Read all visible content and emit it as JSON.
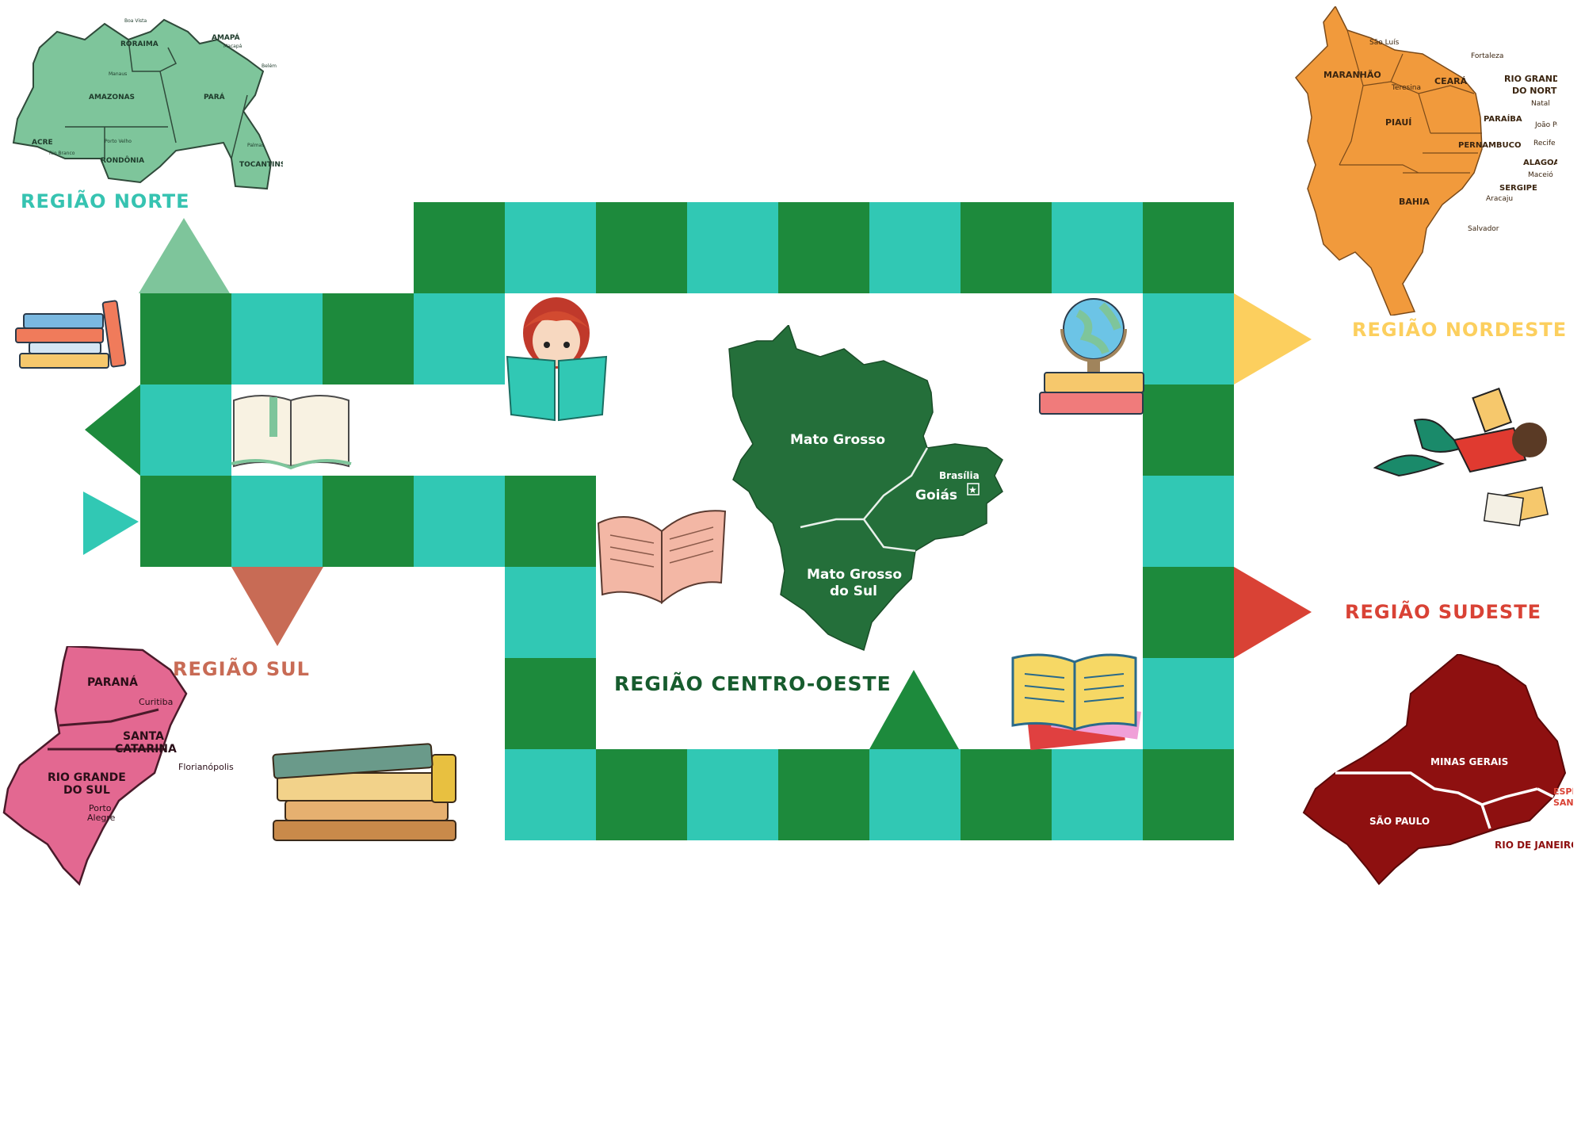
{
  "colors": {
    "dark_green": "#1d8a3c",
    "teal": "#31c8b4",
    "norte": "#7ec59b",
    "nordeste": "#f19a3c",
    "sul": "#e36891",
    "sudeste": "#8e1010",
    "centro_oeste": "#246f3a",
    "label_norte": "#36c3b1",
    "label_nordeste": "#fccf5e",
    "label_sudeste": "#d94235",
    "label_sul": "#c86b55",
    "label_centro": "#175c2e"
  },
  "regions": {
    "norte": {
      "label": "REGIÃO NORTE",
      "states": [
        "RORAIMA",
        "AMAPÁ",
        "AMAZONAS",
        "PARÁ",
        "ACRE",
        "RONDÔNIA",
        "TOCANTINS"
      ],
      "cities": [
        "Boa Vista",
        "Macapá",
        "Manaus",
        "Belém",
        "Rio Branco",
        "Porto Velho",
        "Palmas"
      ]
    },
    "nordeste": {
      "label": "REGIÃO NORDESTE",
      "states": [
        "MARANHÃO",
        "CEARÁ",
        "RIO GRANDE",
        "DO NORTE",
        "PIAUÍ",
        "PARAÍBA",
        "PERNAMBUCO",
        "ALAGOAS",
        "SERGIPE",
        "BAHIA"
      ],
      "cities": [
        "São Luís",
        "Fortaleza",
        "Teresina",
        "Natal",
        "João Pessoa",
        "Recife",
        "Maceió",
        "Aracaju",
        "Salvador"
      ]
    },
    "sul": {
      "label": "REGIÃO SUL",
      "states": [
        "PARANÁ",
        "SANTA",
        "CATARINA",
        "RIO GRANDE",
        "DO SUL"
      ],
      "cities": [
        "Curitiba",
        "Florianópolis",
        "Porto",
        "Alegre"
      ]
    },
    "sudeste": {
      "label": "REGIÃO SUDESTE",
      "states": [
        "MINAS GERAIS",
        "SÃO PAULO",
        "RIO DE JANEIRO",
        "ESPÍRITO",
        "SANTO"
      ]
    },
    "centro_oeste": {
      "label": "REGIÃO CENTRO-OESTE",
      "states": [
        "Mato Grosso",
        "Goiás",
        "Mato Grosso",
        "do Sul"
      ],
      "cities": [
        "Brasília"
      ]
    }
  },
  "board": {
    "icons": [
      "books-stack-icon",
      "open-book-icon",
      "girl-reading-icon",
      "globe-on-books-icon",
      "open-book-pink-icon",
      "open-book-colorful-icon",
      "old-books-stack-icon",
      "boy-reading-icon"
    ]
  }
}
